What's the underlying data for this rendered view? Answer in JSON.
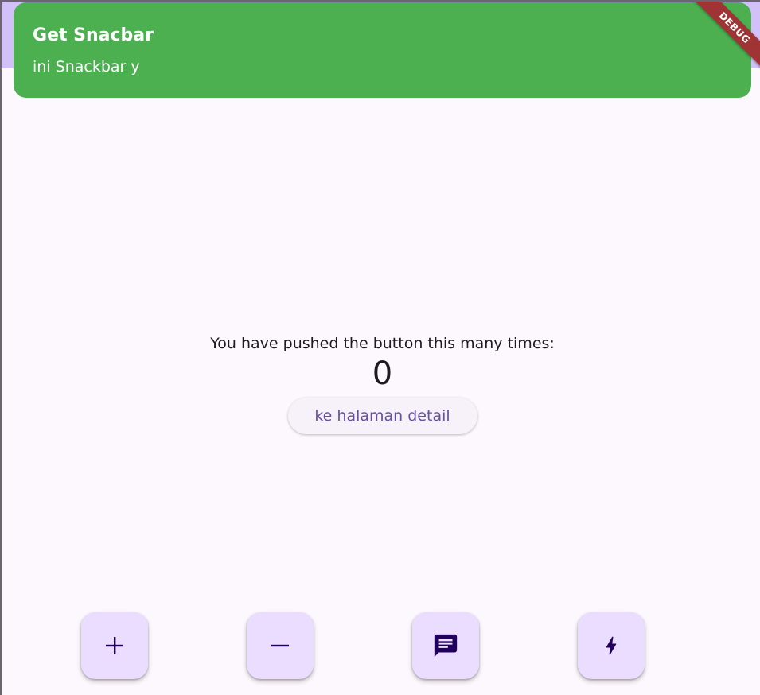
{
  "snackbar": {
    "title": "Get Snacbar",
    "message": "ini Snackbar y",
    "background_color": "#4caf50"
  },
  "debug_banner": {
    "label": "DEBUG"
  },
  "appbar": {
    "background_color": "#d2c0f8"
  },
  "counter": {
    "caption": "You have pushed the button this many times:",
    "value": "0"
  },
  "detail_button": {
    "label": "ke halaman detail"
  },
  "fabs": [
    {
      "icon": "add-icon"
    },
    {
      "icon": "remove-icon"
    },
    {
      "icon": "message-icon"
    },
    {
      "icon": "bolt-icon"
    }
  ],
  "colors": {
    "background": "#fdf7fe",
    "fab_background": "#eaddff",
    "fab_icon": "#21005d",
    "accent": "#6750a4"
  }
}
